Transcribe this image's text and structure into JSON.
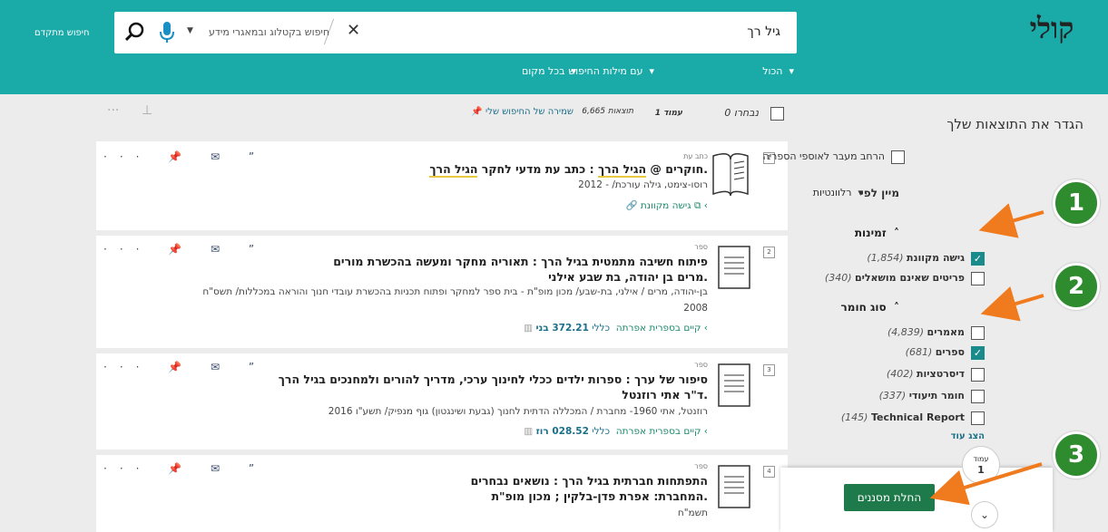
{
  "header": {
    "logo_text": "קולי",
    "advanced_search": "חיפוש מתקדם",
    "search_value": "גיל רך",
    "search_scope": "חיפוש בקטלוג ובמאגרי מידע",
    "filters": [
      {
        "label": "הכול"
      },
      {
        "label": "עם מילות החיפוש"
      },
      {
        "label": "בכל מקום"
      }
    ]
  },
  "results_bar": {
    "selected": "0 נבחרו",
    "page": "עמוד 1",
    "count": "6,665 תוצאות",
    "save_search": "שמירה של החיפוש שלי"
  },
  "sidebar": {
    "title": "הגדר את התוצאות שלך",
    "expand_label": "הרחב מעבר לאוספי הספריה",
    "sort_label": "מיין לפי",
    "sort_value": "רלוונטיות",
    "availability": {
      "heading": "זמינות",
      "items": [
        {
          "label": "גישה מקוונת",
          "count": "(1,854)",
          "checked": true
        },
        {
          "label": "פריטים שאינם מושאלים",
          "count": "(340)",
          "checked": false
        }
      ]
    },
    "material": {
      "heading": "סוג חומר",
      "items": [
        {
          "label": "מאמרים",
          "count": "(4,839)",
          "checked": false
        },
        {
          "label": "ספרים",
          "count": "(681)",
          "checked": true
        },
        {
          "label": "דיסרטציות",
          "count": "(402)",
          "checked": false
        },
        {
          "label": "חומר תיעודי",
          "count": "(337)",
          "checked": false
        },
        {
          "label": "Technical Report",
          "count": "(145)",
          "checked": false
        }
      ]
    },
    "show_more": "הצג עוד"
  },
  "results": [
    {
      "num": "1",
      "type": "כתב עת",
      "title_parts": [
        "חוקרים @ ",
        "הגיל הרך",
        " : כתב עת מדעי לחקר ",
        "הגיל הרך",
        "."
      ],
      "meta": "רוסו-צימט, גילה עורכת/ - 2012",
      "avail": "גישה מקוונת"
    },
    {
      "num": "2",
      "type": "ספר",
      "title_line1": "פיתוח חשיבה מתמטית בגיל הרך : תאוריה מחקר ומעשה בהכשרת מורים",
      "title_line2": "מרים בן יהודה, בת שבע אילני.",
      "meta_line1": "בן-יהודה, מרים / אילני, בת-שבע/ מכון מופ\"ת - בית ספר למחקר ופתוח תכניות בהכשרת עובדי חנוך והוראה במכללות/ תשס\"ח",
      "meta_line2": "2008",
      "avail_prefix": "קיים",
      "avail_location": "בספרית אפרתה",
      "avail_shelf_label": "כללי",
      "avail_shelf": "372.21 בני"
    },
    {
      "num": "3",
      "type": "ספר",
      "title_line1": "סיפור של ערך : ספרות ילדים ככלי לחינוך ערכי, מדריך להורים ולמחנכים בגיל הרך",
      "title_line2": "ד\"ר אתי רוזנטל.",
      "meta_line1": "רוזנטל, אתי 1960- מחברת / המכללה הדתית לחנוך (גבעת ושינגטון) גוף מנפיק/ תשע\"ו 2016",
      "avail_prefix": "קיים",
      "avail_location": "בספרית אפרתה",
      "avail_shelf_label": "כללי",
      "avail_shelf": "028.52 רוז"
    },
    {
      "num": "4",
      "type": "ספר",
      "title_line1": "התפתחות חברתית בגיל הרך : נושאים נבחרים",
      "title_line2": "המחברת: אפרת פדן-בלקין ; מכון מופ\"ת.",
      "meta_line1": "תשמ\"ח"
    }
  ],
  "apply": {
    "label": "החלת מסננים",
    "page_label": "עמוד",
    "page_num": "1"
  },
  "badges": [
    "1",
    "2",
    "3"
  ],
  "colors": {
    "header": "#1aaaa7",
    "badge": "#2e8b2e",
    "arrow": "#f07a1e",
    "apply": "#1e7a4a"
  }
}
